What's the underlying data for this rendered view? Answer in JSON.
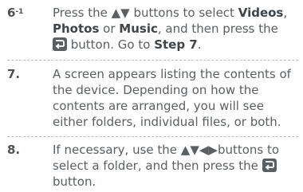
{
  "steps": [
    {
      "number": "6",
      "superscript": "-1",
      "t1": "Press the ",
      "arrows": "▲▼",
      "t2": " buttons to select ",
      "opt1": "Videos",
      "sep1": ",",
      "opt2": "Photos",
      "t3": " or ",
      "opt3": "Music",
      "t4": ", and then press the",
      "t5": " button. Go to ",
      "goto": "Step 7",
      "t6": "."
    },
    {
      "number": "7.",
      "text": "A screen appears listing the contents of the device. Depending on how the contents are arranged, you will see either folders, individual files, or both."
    },
    {
      "number": "8.",
      "t1": "If necessary, use the ",
      "arrows": "▲▼◀▶",
      "t2": "buttons to select a folder, and then press the ",
      "t3": "button."
    }
  ],
  "icons": {
    "enter": "enter-button-icon"
  },
  "colors": {
    "text": "#5a5f63",
    "bold": "#3f4448",
    "icon": "#5a5f63"
  }
}
